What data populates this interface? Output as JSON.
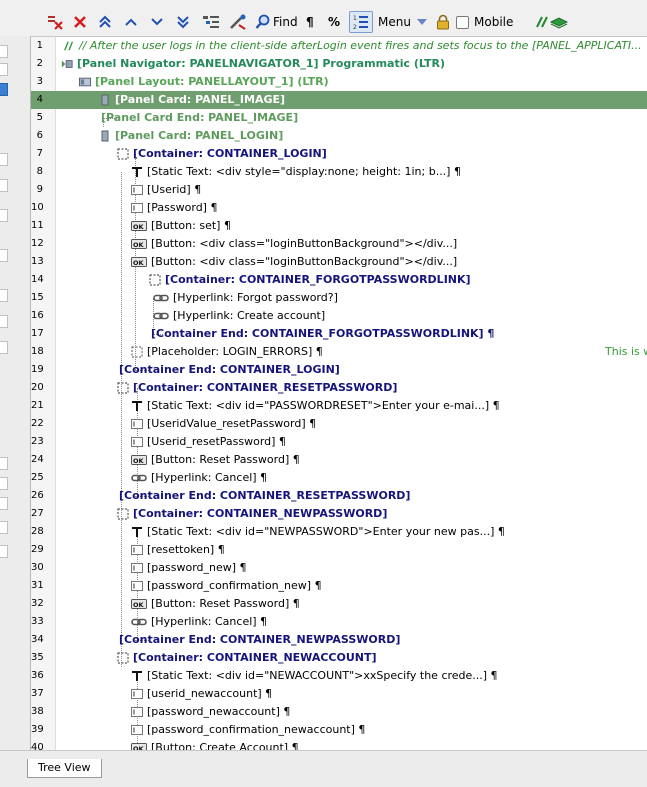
{
  "toolbar": {
    "find_label": "Find",
    "pilcrow_label": "¶",
    "percent_label": "%",
    "menu_label": "Menu",
    "mobile_label": "Mobile",
    "mobile_checked": false
  },
  "tree": {
    "right_note": "This is wl",
    "rows": [
      {
        "n": "1",
        "text": "// After the user logs in the client-side afterLogin event fires and sets focus to the [PANEL_APPLICATI...",
        "kind": "comment",
        "icon": "comment-icon",
        "indent": 0
      },
      {
        "n": "2",
        "text": "[Panel Navigator: PANELNAVIGATOR_1]  Programmatic (LTR)",
        "kind": "nav",
        "icon": "panel-navigator-icon",
        "indent": 0
      },
      {
        "n": "3",
        "text": "[Panel Layout: PANELLAYOUT_1] (LTR)",
        "kind": "layout",
        "icon": "panel-layout-icon",
        "indent": 1
      },
      {
        "n": "4",
        "text": "[Panel Card: PANEL_IMAGE]",
        "kind": "panel",
        "icon": "panel-card-icon",
        "indent": 2
      },
      {
        "n": "5",
        "text": "[Panel Card End: PANEL_IMAGE]",
        "kind": "panel",
        "icon": "",
        "indent": 2
      },
      {
        "n": "6",
        "text": "[Panel Card: PANEL_LOGIN]",
        "kind": "panel",
        "icon": "panel-card-icon",
        "indent": 2
      },
      {
        "n": "7",
        "text": "[Container: CONTAINER_LOGIN]",
        "kind": "container",
        "icon": "container-icon",
        "indent": 3
      },
      {
        "n": "8",
        "text": "[Static Text: <div style=\"display:none; height: 1in; b...] ¶",
        "kind": "item",
        "icon": "static-text-icon",
        "indent": 4
      },
      {
        "n": "9",
        "text": "[Userid] ¶",
        "kind": "item",
        "icon": "textbox-icon",
        "indent": 4
      },
      {
        "n": "10",
        "text": "[Password] ¶",
        "kind": "item",
        "icon": "textbox-icon",
        "indent": 4
      },
      {
        "n": "11",
        "text": "[Button: set] ¶",
        "kind": "item",
        "icon": "button-icon",
        "indent": 4
      },
      {
        "n": "12",
        "text": "[Button: <div class=\"loginButtonBackground\"></div...]",
        "kind": "item",
        "icon": "button-icon",
        "indent": 4
      },
      {
        "n": "13",
        "text": "[Button: <div class=\"loginButtonBackground\"></div...]",
        "kind": "item",
        "icon": "button-icon",
        "indent": 4
      },
      {
        "n": "14",
        "text": "[Container: CONTAINER_FORGOTPASSWORDLINK]",
        "kind": "container",
        "icon": "container-icon",
        "indent": 5
      },
      {
        "n": "15",
        "text": "[Hyperlink: Forgot password?]",
        "kind": "item",
        "icon": "hyperlink-icon",
        "indent": 6
      },
      {
        "n": "16",
        "text": "[Hyperlink: Create account]",
        "kind": "item",
        "icon": "hyperlink-icon",
        "indent": 6
      },
      {
        "n": "17",
        "text": "[Container End: CONTAINER_FORGOTPASSWORDLINK] ¶",
        "kind": "container",
        "icon": "",
        "indent": 5
      },
      {
        "n": "18",
        "text": "[Placeholder: LOGIN_ERRORS] ¶",
        "kind": "item",
        "icon": "placeholder-icon",
        "indent": 4
      },
      {
        "n": "19",
        "text": "[Container End: CONTAINER_LOGIN]",
        "kind": "container",
        "icon": "",
        "indent": 3
      },
      {
        "n": "20",
        "text": "[Container: CONTAINER_RESETPASSWORD]",
        "kind": "container",
        "icon": "container-icon",
        "indent": 3
      },
      {
        "n": "21",
        "text": "[Static Text: <div id=\"PASSWORDRESET\">Enter your e-mai...] ¶",
        "kind": "item",
        "icon": "static-text-icon",
        "indent": 4
      },
      {
        "n": "22",
        "text": "[UseridValue_resetPassword] ¶",
        "kind": "item",
        "icon": "textbox-icon",
        "indent": 4
      },
      {
        "n": "23",
        "text": "[Userid_resetPassword] ¶",
        "kind": "item",
        "icon": "textbox-icon",
        "indent": 4
      },
      {
        "n": "24",
        "text": "[Button: Reset Password] ¶",
        "kind": "item",
        "icon": "button-icon",
        "indent": 4
      },
      {
        "n": "25",
        "text": "[Hyperlink: Cancel] ¶",
        "kind": "item",
        "icon": "hyperlink-icon",
        "indent": 4
      },
      {
        "n": "26",
        "text": "[Container End: CONTAINER_RESETPASSWORD]",
        "kind": "container",
        "icon": "",
        "indent": 3
      },
      {
        "n": "27",
        "text": "[Container: CONTAINER_NEWPASSWORD]",
        "kind": "container",
        "icon": "container-icon",
        "indent": 3
      },
      {
        "n": "28",
        "text": "[Static Text: <div id=\"NEWPASSWORD\">Enter your new pas...] ¶",
        "kind": "item",
        "icon": "static-text-icon",
        "indent": 4
      },
      {
        "n": "29",
        "text": "[resettoken] ¶",
        "kind": "item",
        "icon": "textbox-icon",
        "indent": 4
      },
      {
        "n": "30",
        "text": "[password_new] ¶",
        "kind": "item",
        "icon": "textbox-icon",
        "indent": 4
      },
      {
        "n": "31",
        "text": "[password_confirmation_new] ¶",
        "kind": "item",
        "icon": "textbox-icon",
        "indent": 4
      },
      {
        "n": "32",
        "text": "[Button: Reset Password] ¶",
        "kind": "item",
        "icon": "button-icon",
        "indent": 4
      },
      {
        "n": "33",
        "text": "[Hyperlink: Cancel] ¶",
        "kind": "item",
        "icon": "hyperlink-icon",
        "indent": 4
      },
      {
        "n": "34",
        "text": "[Container End: CONTAINER_NEWPASSWORD]",
        "kind": "container",
        "icon": "",
        "indent": 3
      },
      {
        "n": "35",
        "text": "[Container: CONTAINER_NEWACCOUNT]",
        "kind": "container",
        "icon": "container-icon",
        "indent": 3
      },
      {
        "n": "36",
        "text": "[Static Text: <div id=\"NEWACCOUNT\">xxSpecify the crede...] ¶",
        "kind": "item",
        "icon": "static-text-icon",
        "indent": 4
      },
      {
        "n": "37",
        "text": "[userid_newaccount] ¶",
        "kind": "item",
        "icon": "textbox-icon",
        "indent": 4
      },
      {
        "n": "38",
        "text": "[password_newaccount] ¶",
        "kind": "item",
        "icon": "textbox-icon",
        "indent": 4
      },
      {
        "n": "39",
        "text": "[password_confirmation_newaccount] ¶",
        "kind": "item",
        "icon": "textbox-icon",
        "indent": 4
      },
      {
        "n": "40",
        "text": "[Button: Create Account] ¶",
        "kind": "item",
        "icon": "button-icon",
        "indent": 4
      }
    ]
  },
  "bottom": {
    "tab_label": "Tree View"
  },
  "colors": {
    "highlight_row": "#6f9e6f",
    "container_text": "#14147a",
    "panel_text": "#5d9c5d",
    "comment_text": "#2e8b2e"
  }
}
